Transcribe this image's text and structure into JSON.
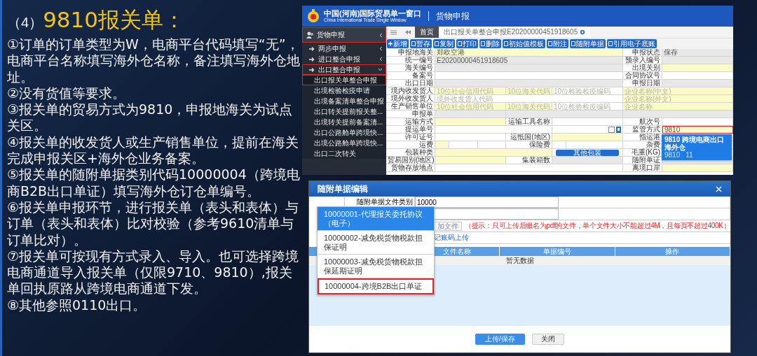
{
  "slide": {
    "heading_prefix": "（4）",
    "heading": "9810报关单：",
    "points": [
      "①订单的订单类型为W，电商平台代码填写“无”，电商平台名称填写海外仓名称，备注填写海外仓地址。",
      "②没有货值等要求。",
      "③报关单的贸易方式为9810，申报地海关为试点关区。",
      "④报关单的收发货人或生产销售单位，提前在海关完成申报关区+海外仓业务备案。",
      "⑤报关单的随附单据类别代码10000004（跨境电商B2B出口单证）填写海外仓订仓单编号。",
      "⑥报关单申报环节，进行报关单（表头和表体）与订单（表头和表体）比对校验（参考9610清单与订单比对）。",
      "⑦报关单可按现有方式录入、导入。也可选择跨境电商通道导入报关单（仅限9710、9810）,报关单回执原路从跨境电商通道下发。",
      "⑧其他参照0110出口。"
    ]
  },
  "portal": {
    "header": {
      "title": "中国(河南)国际贸易单一窗口",
      "subtitle": "China International Trade Single Window",
      "section": "货物申报"
    },
    "sidebar": {
      "items": [
        {
          "label": "货物申报",
          "highlighted": true,
          "children": [
            {
              "label": "两步申报",
              "expanded": false,
              "highlighted": false
            },
            {
              "label": "进口整合申报",
              "expanded": false,
              "highlighted": false
            },
            {
              "label": "出口整合申报",
              "expanded": true,
              "highlighted": true,
              "children": [
                {
                  "label": "出口报关单整合申报",
                  "selected": true,
                  "highlighted": true
                },
                {
                  "label": "出境检验检疫申请",
                  "selected": false,
                  "highlighted": false
                },
                {
                  "label": "出境备案清单整合申报",
                  "selected": false,
                  "highlighted": false
                },
                {
                  "label": "出口转关提前报关整...",
                  "selected": false,
                  "highlighted": false
                },
                {
                  "label": "出境转关提前备案清...",
                  "selected": false,
                  "highlighted": false
                },
                {
                  "label": "出口公路舱单跨境快...",
                  "selected": false,
                  "highlighted": false
                },
                {
                  "label": "出境公路舱单跨境快...",
                  "selected": false,
                  "highlighted": false
                },
                {
                  "label": "出口二次转关",
                  "selected": false,
                  "highlighted": false
                }
              ]
            }
          ]
        }
      ]
    },
    "tabs": [
      {
        "label": "首页",
        "selected": false
      },
      {
        "label": "出口报关单整合申报E20200000451918605",
        "selected": true
      }
    ],
    "toolbar": [
      "新增",
      "暂存",
      "复制",
      "打印",
      "删除",
      "初始值模板",
      "附注",
      "随附单据",
      "引用电子底账"
    ],
    "form": {
      "rows": [
        {
          "cells": [
            {
              "kind": "label",
              "text": "申报地海关"
            },
            {
              "kind": "required",
              "value": "郑欧空港"
            },
            "",
            "",
            {
              "kind": "label",
              "text": "申报状态"
            },
            {
              "kind": "readonly",
              "value": "保存"
            }
          ]
        },
        {
          "cells": [
            {
              "kind": "label",
              "text": "统一编号"
            },
            {
              "kind": "readonly",
              "value": "E20200000451918605"
            },
            "",
            "",
            {
              "kind": "label",
              "text": "预录入编号"
            },
            {
              "kind": "readonly"
            }
          ]
        },
        {
          "cells": [
            {
              "kind": "label",
              "text": "海关编号"
            },
            {
              "kind": "readonly"
            },
            "",
            "",
            {
              "kind": "label",
              "text": "出境关别"
            },
            {
              "kind": "required"
            }
          ]
        },
        {
          "cells": [
            {
              "kind": "label",
              "text": "备案号"
            },
            {
              "kind": "input"
            },
            "",
            "",
            {
              "kind": "label",
              "text": "合同协议号"
            },
            {
              "kind": "input"
            }
          ]
        },
        {
          "cells": [
            {
              "kind": "label",
              "text": "出口日期"
            },
            {
              "kind": "readonly"
            },
            "",
            "",
            {
              "kind": "label",
              "text": "申报日期"
            },
            {
              "kind": "readonly"
            }
          ]
        },
        {
          "cells": [
            {
              "kind": "label",
              "text": "境内收发货人"
            },
            {
              "kind": "required",
              "placeholder": "10位社会信用代码"
            },
            {
              "kind": "required",
              "placeholder": "10位海关代码"
            },
            {
              "kind": "input",
              "placeholder": "10位检验检疫编码"
            },
            {
              "kind": "required",
              "placeholder": "企业名称(中文)"
            },
            ""
          ]
        },
        {
          "cells": [
            {
              "kind": "label",
              "text": "境外收发货人"
            },
            {
              "kind": "input",
              "placeholder": "境外收发货人代码"
            },
            "",
            "",
            {
              "kind": "required",
              "placeholder": "企业名称(外文)"
            },
            ""
          ]
        },
        {
          "cells": [
            {
              "kind": "label",
              "text": "生产销售单位"
            },
            {
              "kind": "required",
              "placeholder": "10位社会信用代码"
            },
            {
              "kind": "required",
              "placeholder": "10位海关代码"
            },
            {
              "kind": "input",
              "placeholder": "10位检验检疫编码"
            },
            {
              "kind": "required",
              "placeholder": "企业名称"
            },
            ""
          ]
        },
        {
          "cells": [
            {
              "kind": "label",
              "text": "申报单"
            },
            {
              "kind": "readonly"
            },
            {
              "kind": "readonly"
            },
            "",
            {
              "kind": "readonly"
            },
            ""
          ]
        },
        {
          "cells": [
            {
              "kind": "label",
              "text": "运输方式"
            },
            {
              "kind": "required"
            },
            {
              "kind": "label",
              "text": "运输工具名称"
            },
            {
              "kind": "input"
            },
            {
              "kind": "label",
              "text": "航次号"
            },
            {
              "kind": "input"
            }
          ]
        },
        {
          "cells": [
            {
              "kind": "label",
              "text": "提运单号"
            },
            {
              "kind": "input"
            },
            "",
            {
              "kind": "checkbox",
              "checked": false
            },
            {
              "kind": "label",
              "text": "监管方式"
            },
            {
              "kind": "required",
              "value": "9810",
              "highlighted": true
            }
          ]
        },
        {
          "cells": [
            {
              "kind": "label",
              "text": "许可证号"
            },
            {
              "kind": "input"
            },
            {
              "kind": "label",
              "text": "运抵国(地区)"
            },
            {
              "kind": "required"
            },
            {
              "kind": "label",
              "text": "指运港"
            },
            {
              "kind": "input"
            }
          ]
        },
        {
          "cells": [
            {
              "kind": "label",
              "text": "运费"
            },
            {
              "kind": "split",
              "parts": [
                {
                  "kind": "required"
                },
                {
                  "kind": "input"
                },
                {
                  "kind": "input"
                }
              ]
            },
            {
              "kind": "label",
              "text": "保险费"
            },
            {
              "kind": "split",
              "parts": [
                {
                  "kind": "input"
                },
                {
                  "kind": "input"
                }
              ]
            },
            {
              "kind": "label",
              "text": "杂费"
            },
            {
              "kind": "input"
            }
          ]
        },
        {
          "cells": [
            {
              "kind": "label",
              "text": "包装种类"
            },
            {
              "kind": "required"
            },
            "",
            {
              "kind": "button",
              "text": "其他包装"
            },
            {
              "kind": "label",
              "text": "毛重(KG)"
            },
            {
              "kind": "required"
            }
          ]
        },
        {
          "cells": [
            {
              "kind": "label",
              "text": "贸易国别(地区)"
            },
            {
              "kind": "required"
            },
            {
              "kind": "label",
              "text": "集装箱数"
            },
            {
              "kind": "readonly"
            },
            {
              "kind": "label",
              "text": "随附单证"
            },
            {
              "kind": "readonly"
            }
          ]
        },
        {
          "cells": [
            {
              "kind": "label",
              "text": "货物存放地点"
            },
            {
              "kind": "input"
            },
            "",
            "",
            {
              "kind": "label",
              "text": "离境口岸"
            },
            {
              "kind": "required"
            }
          ]
        }
      ]
    },
    "type_popup": {
      "label": "9810 跨境电商出口海外仓",
      "column_2": "9810",
      "column_3": "11"
    }
  },
  "dialog": {
    "title": "随附单据编辑",
    "field": {
      "label": "随附单据文件类别",
      "value": "10000"
    },
    "add_file_button": "加文件",
    "hint": "（提示：只可上传后缀名为pdf的文件，单个文件大小不能超过4M，且每页不超过400K）",
    "upload_link": "记账码上传",
    "table": {
      "columns": [
        "文件名称",
        "单据编号",
        "操作"
      ],
      "empty_text": "暂无数据"
    },
    "dropdown": {
      "options": [
        {
          "label": "10000001-代理报关委托协议（电子）",
          "selected": true,
          "highlighted": false
        },
        {
          "label": "10000002-减免税货物税款担保证明",
          "selected": false,
          "highlighted": false
        },
        {
          "label": "10000003-减免税货物税款担保延期证明",
          "selected": false,
          "highlighted": false
        },
        {
          "label": "10000004-跨境B2B出口单证",
          "selected": false,
          "highlighted": true
        }
      ]
    },
    "buttons": [
      {
        "label": "上传/保存",
        "kind": "primary"
      },
      {
        "label": "关闭",
        "kind": "secondary"
      }
    ]
  }
}
